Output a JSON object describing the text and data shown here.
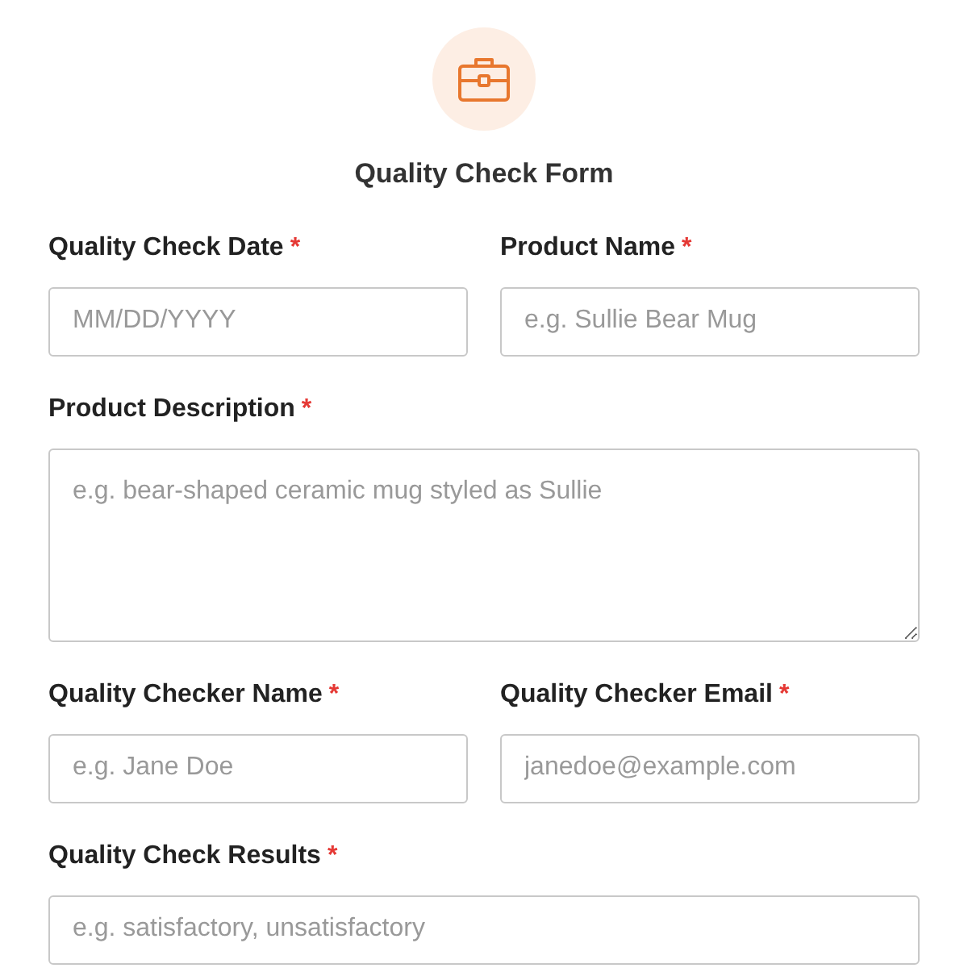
{
  "form": {
    "title": "Quality Check Form",
    "rows": [
      [
        {
          "label": "Quality Check Date",
          "required_mark": "*",
          "kind": "input",
          "placeholder": "MM/DD/YYYY"
        },
        {
          "label": "Product Name",
          "required_mark": "*",
          "kind": "input",
          "placeholder": "e.g. Sullie Bear Mug"
        }
      ],
      [
        {
          "label": "Product Description",
          "required_mark": "*",
          "kind": "textarea",
          "placeholder": "e.g. bear-shaped ceramic mug styled as Sullie"
        }
      ],
      [
        {
          "label": "Quality Checker Name",
          "required_mark": "*",
          "kind": "input",
          "placeholder": "e.g. Jane Doe"
        },
        {
          "label": "Quality Checker Email",
          "required_mark": "*",
          "kind": "input",
          "placeholder": "janedoe@example.com"
        }
      ],
      [
        {
          "label": "Quality Check Results",
          "required_mark": "*",
          "kind": "input",
          "placeholder": "e.g. satisfactory, unsatisfactory"
        }
      ]
    ]
  }
}
